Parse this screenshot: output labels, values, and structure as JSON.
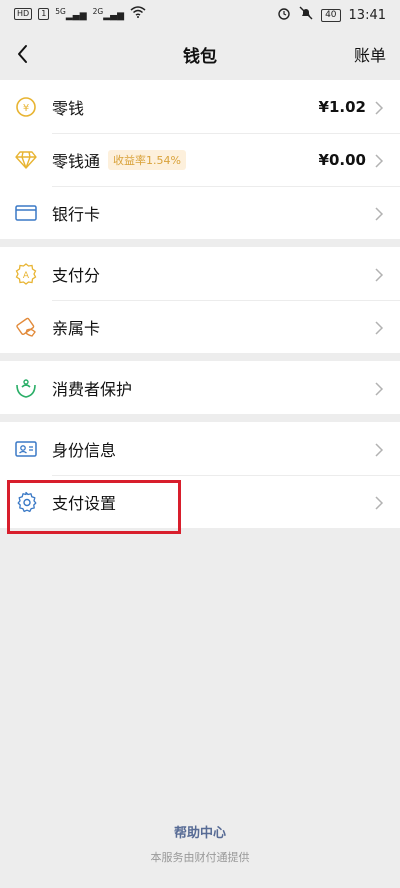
{
  "status": {
    "left_icons": [
      "HD",
      "1",
      "5G",
      "2G",
      "wifi"
    ],
    "battery": "40",
    "time": "13:41"
  },
  "nav": {
    "back_icon": "back-chevron-icon",
    "title": "钱包",
    "action": "账单"
  },
  "groups": [
    {
      "rows": [
        {
          "icon": "coin-icon",
          "label": "零钱",
          "value": "¥1.02"
        },
        {
          "icon": "diamond-icon",
          "label": "零钱通",
          "badge": "收益率1.54%",
          "value": "¥0.00"
        },
        {
          "icon": "bank-card-icon",
          "label": "银行卡"
        }
      ]
    },
    {
      "rows": [
        {
          "icon": "pay-score-icon",
          "label": "支付分"
        },
        {
          "icon": "family-card-icon",
          "label": "亲属卡"
        }
      ]
    },
    {
      "rows": [
        {
          "icon": "consumer-protect-icon",
          "label": "消费者保护"
        }
      ]
    },
    {
      "rows": [
        {
          "icon": "identity-icon",
          "label": "身份信息"
        },
        {
          "icon": "gear-icon",
          "label": "支付设置"
        }
      ]
    }
  ],
  "footer": {
    "help": "帮助中心",
    "provider": "本服务由财付通提供"
  },
  "colors": {
    "accent_gold": "#e8b432",
    "green": "#2aae67",
    "blue": "#3a79c6",
    "highlight": "#d81e2c"
  }
}
